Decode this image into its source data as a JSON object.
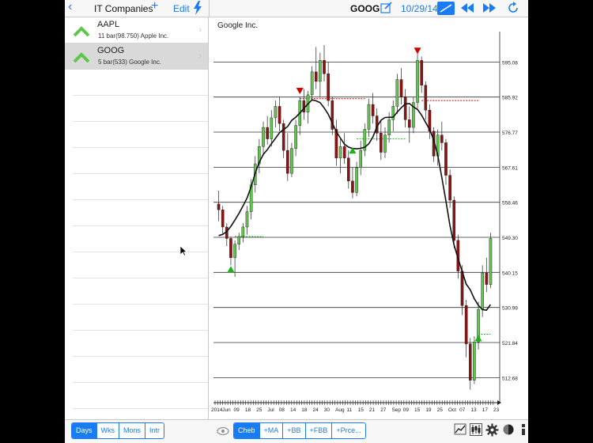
{
  "header": {
    "back_icon": "chevron-left-icon",
    "list_title": "IT Companies",
    "add_label": "+",
    "edit_label": "Edit",
    "flash_icon": "lightning-icon",
    "symbol": "GOOG",
    "edit_icon": "pencil-square-icon",
    "date": "10/29/14",
    "rewind_icon": "rewind-icon",
    "fastforward_icon": "fast-forward-icon",
    "refresh_icon": "refresh-icon"
  },
  "watchlist": [
    {
      "symbol": "AAPL",
      "detail": "11 bar(98.750) Apple Inc.",
      "selected": false
    },
    {
      "symbol": "GOOG",
      "detail": "5 bar(533) Google Inc.",
      "selected": true
    }
  ],
  "chart_data": {
    "type": "candlestick",
    "title": "Google Inc.",
    "y_ticks": [
      "595.08",
      "585.92",
      "576.77",
      "567.61",
      "558.46",
      "549.30",
      "540.15",
      "530.99",
      "521.84",
      "512.68"
    ],
    "ylim": [
      508,
      603
    ],
    "x_ticks": [
      "2014",
      "Jun",
      "09",
      "18",
      "25",
      "Jul",
      "08",
      "14",
      "18",
      "24",
      "30",
      "Aug",
      "11",
      "15",
      "21",
      "27",
      "Sep",
      "09",
      "15",
      "19",
      "25",
      "Oct",
      "07",
      "13",
      "17",
      "23"
    ],
    "candles": [
      [
        558.0,
        561.5,
        553.5,
        556.5
      ],
      [
        556.5,
        557.5,
        550.0,
        552.0
      ],
      [
        552.0,
        553.0,
        547.0,
        549.0
      ],
      [
        549.0,
        549.5,
        542.0,
        544.0
      ],
      [
        544.0,
        548.5,
        539.0,
        547.5
      ],
      [
        547.5,
        550.5,
        546.0,
        549.5
      ],
      [
        549.5,
        553.0,
        548.0,
        552.0
      ],
      [
        552.0,
        557.5,
        550.0,
        556.0
      ],
      [
        556.0,
        564.5,
        554.0,
        563.0
      ],
      [
        563.0,
        570.5,
        561.0,
        568.5
      ],
      [
        568.5,
        575.0,
        566.0,
        573.0
      ],
      [
        573.0,
        579.5,
        571.0,
        578.0
      ],
      [
        578.0,
        581.0,
        573.5,
        575.0
      ],
      [
        575.0,
        582.5,
        573.0,
        580.5
      ],
      [
        580.5,
        585.0,
        578.0,
        583.5
      ],
      [
        583.5,
        586.0,
        577.0,
        579.0
      ],
      [
        579.0,
        580.0,
        570.0,
        572.0
      ],
      [
        572.0,
        576.5,
        564.0,
        566.0
      ],
      [
        566.0,
        574.0,
        565.0,
        572.5
      ],
      [
        572.5,
        580.0,
        570.5,
        578.5
      ],
      [
        578.5,
        586.0,
        576.0,
        585.0
      ],
      [
        585.0,
        588.0,
        580.0,
        582.0
      ],
      [
        582.0,
        587.5,
        579.0,
        586.5
      ],
      [
        586.5,
        594.0,
        585.0,
        592.5
      ],
      [
        592.5,
        599.0,
        588.0,
        590.0
      ],
      [
        590.0,
        597.5,
        586.0,
        595.5
      ],
      [
        595.5,
        599.5,
        590.0,
        592.0
      ],
      [
        592.0,
        595.0,
        583.5,
        585.0
      ],
      [
        585.0,
        586.0,
        576.0,
        577.5
      ],
      [
        577.5,
        580.0,
        568.0,
        570.0
      ],
      [
        570.0,
        575.0,
        566.0,
        573.0
      ],
      [
        573.0,
        576.5,
        568.5,
        570.0
      ],
      [
        570.0,
        572.0,
        562.0,
        564.0
      ],
      [
        564.0,
        567.5,
        559.5,
        561.0
      ],
      [
        561.0,
        569.0,
        560.0,
        567.5
      ],
      [
        567.5,
        574.5,
        565.5,
        572.0
      ],
      [
        572.0,
        579.0,
        570.5,
        577.5
      ],
      [
        577.5,
        585.5,
        575.5,
        584.0
      ],
      [
        584.0,
        587.0,
        579.0,
        581.0
      ],
      [
        581.0,
        583.0,
        574.5,
        576.5
      ],
      [
        576.5,
        580.0,
        569.5,
        571.5
      ],
      [
        571.5,
        578.0,
        570.0,
        576.0
      ],
      [
        576.0,
        582.0,
        574.0,
        580.0
      ],
      [
        580.0,
        585.0,
        577.0,
        583.5
      ],
      [
        583.5,
        592.0,
        581.5,
        590.5
      ],
      [
        590.5,
        593.5,
        584.0,
        586.0
      ],
      [
        586.0,
        588.0,
        578.0,
        580.0
      ],
      [
        580.0,
        583.5,
        574.0,
        578.0
      ],
      [
        578.0,
        586.0,
        576.5,
        584.5
      ],
      [
        584.5,
        597.5,
        583.0,
        595.5
      ],
      [
        595.5,
        596.5,
        587.0,
        589.0
      ],
      [
        589.0,
        590.0,
        580.0,
        582.5
      ],
      [
        582.5,
        584.0,
        575.0,
        577.0
      ],
      [
        577.0,
        578.0,
        569.0,
        570.5
      ],
      [
        570.5,
        577.5,
        568.0,
        576.0
      ],
      [
        576.0,
        579.5,
        572.0,
        574.0
      ],
      [
        574.0,
        575.0,
        563.0,
        565.5
      ],
      [
        565.5,
        567.0,
        557.0,
        559.0
      ],
      [
        559.0,
        560.0,
        546.5,
        548.5
      ],
      [
        548.5,
        550.0,
        538.5,
        540.5
      ],
      [
        540.5,
        542.0,
        529.0,
        531.5
      ],
      [
        531.5,
        533.0,
        518.0,
        521.5
      ],
      [
        521.5,
        523.0,
        509.5,
        512.0
      ],
      [
        512.0,
        523.5,
        511.0,
        522.0
      ],
      [
        522.0,
        532.5,
        520.0,
        530.5
      ],
      [
        530.5,
        542.0,
        528.5,
        540.0
      ],
      [
        540.0,
        544.0,
        535.0,
        537.0
      ],
      [
        537.0,
        550.5,
        536.0,
        549.0
      ]
    ],
    "trend_line": "curve",
    "markers": [
      {
        "type": "sell",
        "index": 20,
        "price": 587.5
      },
      {
        "type": "sell",
        "index": 49,
        "price": 598.0
      },
      {
        "type": "buy",
        "index": 3,
        "price": 541.0
      },
      {
        "type": "buy",
        "index": 33,
        "price": 572.0
      },
      {
        "type": "buy",
        "index": 64,
        "price": 523.0
      }
    ],
    "hlines": [
      {
        "type": "resistance",
        "price": 585.5,
        "from_index": 20,
        "to_index": 36,
        "color": "#d00000"
      },
      {
        "type": "resistance",
        "price": 585.0,
        "from_index": 50,
        "to_index": 64,
        "color": "#d00000"
      },
      {
        "type": "support",
        "price": 549.5,
        "from_index": 4,
        "to_index": 11,
        "color": "#19b419"
      },
      {
        "type": "support",
        "price": 575.0,
        "from_index": 34,
        "to_index": 46,
        "color": "#19b419"
      },
      {
        "type": "support",
        "price": 524.0,
        "from_index": 64,
        "to_index": 67,
        "color": "#19b419"
      }
    ],
    "colors": {
      "up": "#5ec64a",
      "down": "#8b1313",
      "trend": "#111111",
      "grid": "#333333",
      "buy": "#19b419",
      "sell": "#d00000"
    }
  },
  "footer": {
    "periods": [
      "Days",
      "Wks",
      "Mons",
      "Intr"
    ],
    "active_period": "Days",
    "eye_icon": "eye-icon",
    "indicators": [
      "Cheb",
      "+MA",
      "+BB",
      "+FBB",
      "+Prce..."
    ],
    "active_indicator": "Cheb",
    "chart_icon": "line-chart-icon",
    "candle_icon": "candlestick-icon",
    "settings_icon": "gear-icon",
    "contrast_icon": "contrast-icon",
    "info_icon": "info-icon"
  },
  "accent": "#1a7cf5"
}
